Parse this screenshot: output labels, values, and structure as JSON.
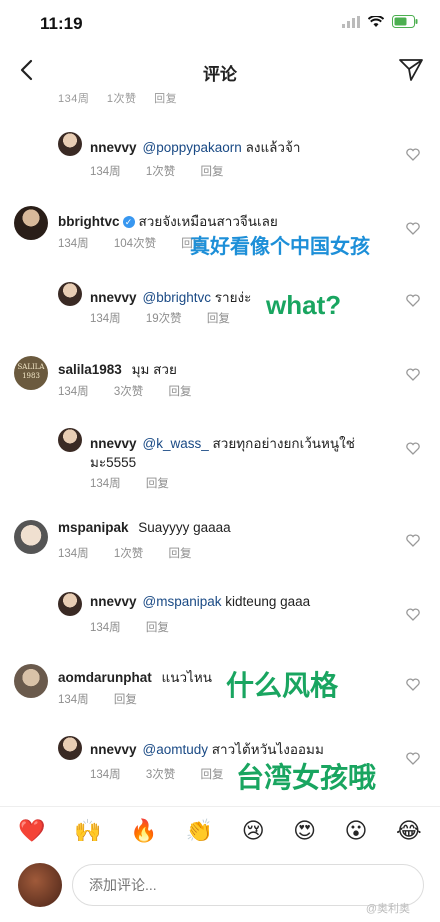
{
  "status": {
    "time": "11:19"
  },
  "nav": {
    "title": "评论"
  },
  "top_fragment": {
    "weeks": "134周",
    "likes": "1次赞",
    "reply": "回复"
  },
  "comments": [
    {
      "user": "nnevvy",
      "mention": "@poppypakaorn",
      "text": "ลงแล้วจ้า",
      "weeks": "134周",
      "likes": "1次赞",
      "reply": "回复"
    },
    {
      "user": "bbrightvc",
      "verified": true,
      "text": "สวยจังเหมือนสาวจีนเลย",
      "weeks": "134周",
      "likes": "104次赞",
      "reply": "回复",
      "overlay": "真好看像个中国女孩"
    },
    {
      "user": "nnevvy",
      "mention": "@bbrightvc",
      "text": "รายง่ะ",
      "weeks": "134周",
      "likes": "19次赞",
      "reply": "回复",
      "overlay": "what?"
    },
    {
      "user": "salila1983",
      "text": "มุม สวย",
      "weeks": "134周",
      "likes": "3次赞",
      "reply": "回复",
      "avatar_text": "SALILA 1983"
    },
    {
      "user": "nnevvy",
      "mention": "@k_wass_",
      "text": "สวยทุกอย่างยกเว้นหนูใช่",
      "text2": "มะ5555",
      "weeks": "134周",
      "reply": "回复"
    },
    {
      "user": "mspanipak",
      "text": "Suayyyy gaaaa",
      "weeks": "134周",
      "likes": "1次赞",
      "reply": "回复"
    },
    {
      "user": "nnevvy",
      "mention": "@mspanipak",
      "text": "kidteung gaaa",
      "weeks": "134周",
      "reply": "回复"
    },
    {
      "user": "aomdarunphat",
      "text": "แนวไหน",
      "weeks": "134周",
      "reply": "回复",
      "overlay": "什么风格"
    },
    {
      "user": "nnevvy",
      "mention": "@aomtudy",
      "text": "สาวไต้หวันไงออมม",
      "weeks": "134周",
      "likes": "3次赞",
      "reply": "回复",
      "overlay": "台湾女孩哦"
    }
  ],
  "emoji_bar": [
    "❤️",
    "🙌",
    "🔥",
    "👏",
    "😢",
    "😍",
    "😮",
    "😂"
  ],
  "input": {
    "placeholder": "添加评论..."
  },
  "watermark": "@奥利奥"
}
